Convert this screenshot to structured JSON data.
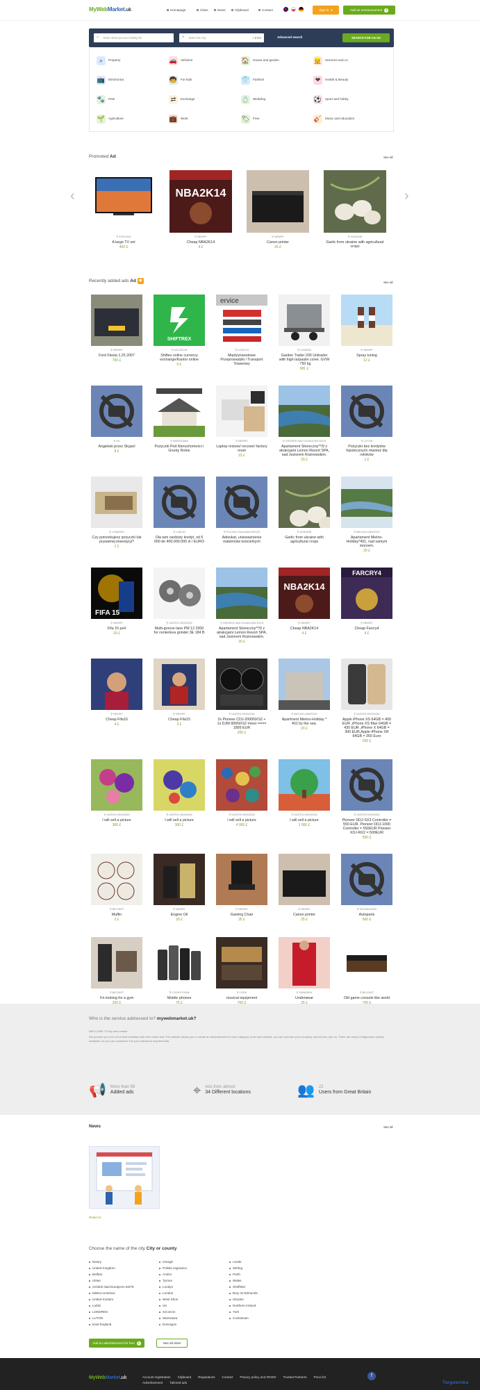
{
  "header": {
    "logo": {
      "my": "MyWeb",
      "market": "Market",
      "tld": ".uk"
    },
    "nav": [
      "Homepage",
      "Cities",
      "News",
      "Clipboard",
      "Contact"
    ],
    "sign_in": "Sign in",
    "add_announcement": "Add an announcement"
  },
  "search": {
    "what_placeholder": "Enter what you are looking for",
    "where_placeholder": "Enter the city",
    "radius": "+ 0 km",
    "advanced": "Advanced search",
    "button": "SEARCH FOR AN AD"
  },
  "categories": [
    {
      "label": "Property",
      "icon": "magnifier-house-icon"
    },
    {
      "label": "Vehicles",
      "icon": "car-icon"
    },
    {
      "label": "House and garden",
      "icon": "house-icon"
    },
    {
      "label": "Services and co.",
      "icon": "worker-icon"
    },
    {
      "label": "Electronics",
      "icon": "tv-icon"
    },
    {
      "label": "For kids",
      "icon": "kid-icon"
    },
    {
      "label": "Fashion",
      "icon": "shirt-icon"
    },
    {
      "label": "Health & Beauty",
      "icon": "heart-icon"
    },
    {
      "label": "Pets",
      "icon": "paw-icon"
    },
    {
      "label": "Exchange",
      "icon": "exchange-icon"
    },
    {
      "label": "Wedding",
      "icon": "rings-icon"
    },
    {
      "label": "Sport and hobby",
      "icon": "ball-icon"
    },
    {
      "label": "Agriculture",
      "icon": "plant-icon"
    },
    {
      "label": "Work",
      "icon": "briefcase-icon"
    },
    {
      "label": "Free",
      "icon": "tag-icon"
    },
    {
      "label": "Music and education",
      "icon": "guitar-icon"
    }
  ],
  "promoted": {
    "title_pre": "Promoted",
    "title_b": "Ad",
    "see_all": "See all",
    "items": [
      {
        "loc": "STIRLING",
        "title": "A large TV set",
        "price": "400 £"
      },
      {
        "loc": "NEWRY",
        "title": "Cheap NBA2K14",
        "price": "4 £"
      },
      {
        "loc": "NEWRY",
        "title": "Canon printer",
        "price": "25 £"
      },
      {
        "loc": "UKRAINE",
        "title": "Garlic from ukraine with agricultural crops",
        "price": ""
      }
    ]
  },
  "recent": {
    "title_pre": "Recently added ads",
    "title_b": "Ad",
    "see_all": "See all",
    "items": [
      {
        "loc": "NEWRY",
        "title": "Ford Fiesta 1,25 2007",
        "price": "700 £"
      },
      {
        "loc": "SZCZECIN",
        "title": "Shiftex online currency exchange/Kantor online",
        "price": "0 £"
      },
      {
        "loc": "LONDYN",
        "title": "Międzynarodowe Przeprowadzki i Transport Towarowy",
        "price": ""
      },
      {
        "loc": "LONDON",
        "title": "Garden Trailer 200 Unitrailer with high tarpaulin cover. GVW : 750 kg",
        "price": "581 £"
      },
      {
        "loc": "NEWRY",
        "title": "Spray tuning",
        "price": "12 £"
      },
      {
        "loc": "UK",
        "title": "Angielski przez Skypel",
        "price": "8 £"
      },
      {
        "loc": "WARSZAWA",
        "title": "Pożyczki Pod Nieruchomości i Grunty Rolne",
        "price": ""
      },
      {
        "loc": "NEWRY",
        "title": "Laptop restore/ recover/ factory reset",
        "price": "15 £"
      },
      {
        "loc": "GRÓDEK NAD DUNAJCEM 83/78",
        "title": "Apartament Słoneczny**/9 z atrakcjami Lemon Resort SPA, nad Jeziorem Rożnowskim.",
        "price": "20 £"
      },
      {
        "loc": "LUTON",
        "title": "Pożyczki bez kredytów hipotecznych również dla rolników",
        "price": "1 £"
      },
      {
        "loc": "LONDRES",
        "title": "Czy potrzebujesz pożyczki lub prywatnej inwestycji?",
        "price": "1 £"
      },
      {
        "loc": "LUBLIN",
        "title": "Ola tam osobisty kredyt, od 5 000 do 400.000.000 zł / EURO",
        "price": ""
      },
      {
        "loc": "POLSKA CAŁA/MAZOWSZE",
        "title": "Adwokat, unieważnienie małżeństw kościelnych",
        "price": ""
      },
      {
        "loc": "UKRAINE",
        "title": "Garlic from ukraine with agricultural crops",
        "price": ""
      },
      {
        "loc": "MIELNO-UNIEŚCIE",
        "title": "Apartament Mielno-Holiday*401, nad samym morzem.",
        "price": "20 £"
      },
      {
        "loc": "NEWRY",
        "title": "Fifa 15 ps4",
        "price": "20 £"
      },
      {
        "loc": "UNITED KINGDOM",
        "title": "Multi-groove lane PM 12 2000 for centerless grinder 3E 184 B",
        "price": ""
      },
      {
        "loc": "GRÓDEK NAD DUNAJCEM 83/78",
        "title": "Apartament Słoneczny**/9 z atrakcjami Lemon Resort SPA, nad Jeziorem Rożnowskim.",
        "price": "20 £"
      },
      {
        "loc": "NEWRY",
        "title": "Cheap NBA2K14",
        "price": "4 £"
      },
      {
        "loc": "NEWRY",
        "title": "Cheap Farcry4",
        "price": "4 £"
      },
      {
        "loc": "NEWRY",
        "title": "Cheap Fifa16",
        "price": "4 £"
      },
      {
        "loc": "NEWRY",
        "title": "Cheap Fifa15",
        "price": "3 £"
      },
      {
        "loc": "UNITED KINGDOM",
        "title": "2x Pioneer CDJ-2000NXS2 + 1x DJM-900NXS2 mixer ==== 1899 EUR",
        "price": "200 £"
      },
      {
        "loc": "MIELNO-UNIEŚCIE",
        "title": "Apartment Mielno-Holiday * 401 by the sea.",
        "price": "20 £"
      },
      {
        "loc": "UNITED KINGDOM",
        "title": "Apple iPhone XS 64GB = 400 EUR ,iPhone XS Max 64GB = 430 EUR ,iPhone X 64GB = 300 EUR,Apple iPhone XR 64GB = 350 Euro",
        "price": "200 £"
      },
      {
        "loc": "UNITED KINGDOM",
        "title": "I will sell a picture",
        "price": "300 £"
      },
      {
        "loc": "UNITED KINGDOM",
        "title": "I will sell a picture",
        "price": "300 £"
      },
      {
        "loc": "UNITED KINGDOM",
        "title": "I will sell a picture",
        "price": "4 000 £"
      },
      {
        "loc": "UNITED KINGDOM",
        "title": "I will sell a picture",
        "price": "1 000 £"
      },
      {
        "loc": "UNITED KINGDOM",
        "title": "Pioneer DDJ-SX3 Controller = 550 EUR, Pioneer DDJ-1000 Controller = 550EUR Pioneer XDJ-RX2 = 500EUR",
        "price": "550 £"
      },
      {
        "loc": "BELFAST",
        "title": "Muffin",
        "price": "2 £"
      },
      {
        "loc": "NEWRY",
        "title": "Engine Oil",
        "price": "30 £"
      },
      {
        "loc": "NEWRY",
        "title": "Gaming Chair",
        "price": "35 £"
      },
      {
        "loc": "NEWRY",
        "title": "Canon printer",
        "price": "25 £"
      },
      {
        "loc": "SOSNAGORA",
        "title": "Autoparts",
        "price": "500 £"
      },
      {
        "loc": "BELFAST",
        "title": "I'm looking for a gym",
        "price": "200 £"
      },
      {
        "loc": "COOKSTOWN",
        "title": "Mobile phones",
        "price": "75 £"
      },
      {
        "loc": "YORK",
        "title": "musical equipment",
        "price": "700 £"
      },
      {
        "loc": "SWANSEA",
        "title": "Underwear",
        "price": "25 £"
      },
      {
        "loc": "BELFAST",
        "title": "Old game console like world",
        "price": "700 £"
      }
    ]
  },
  "about": {
    "q_pre": "Who is the service addressed to?",
    "q_b": "mywebmarket.uk?",
    "welcome": "WELCOME TO My web market",
    "text": "We present you one of the best websites with free online ads! The website allows you to create an advertisement in each category, local and national, you can promote your company and service, join us. There are many configuration options available, so you can customize it to your individual requirements.",
    "stats": [
      {
        "num": "More than 59",
        "label": "Added ads"
      },
      {
        "num": "Ads from almost",
        "label": "34 Different locations"
      },
      {
        "num": "22",
        "label": "Users from Great Britain"
      }
    ]
  },
  "news": {
    "title": "News",
    "see_all": "See all",
    "read_on": "Read on"
  },
  "cities": {
    "title_pre": "Choose the name of the city",
    "title_b": "City or county",
    "cols": [
      [
        "Newry",
        "United Kingdom",
        "Belfast",
        "Ulster",
        "Gródek Nad Dunajcem 83/78",
        "Mielno-Unieście",
        "United Kindom",
        "Lublin",
        "LONDRES",
        "LUTON",
        "East England"
      ],
      [
        "Omagh",
        "Polska zagranica",
        "Antrim",
        "Tyrone",
        "Londyn",
        "London",
        "West Shoe",
        "UK",
        "Szczecin",
        "Warszawa",
        "Dunragon"
      ],
      [
        "Leeds",
        "Stirling",
        "Perth",
        "Wales",
        "Sheffield",
        "Bury St Edmunds",
        "Ukraine",
        "Northern Ireland",
        "York",
        "Cookstown"
      ],
      []
    ],
    "add_free": "Add an advertisement for free",
    "see_all_cities": "See all cities"
  },
  "footer": {
    "links": [
      "Account registration",
      "Clipboard",
      "Regulations",
      "Contact",
      "Privacy policy and RODO",
      "Trusted Partners",
      "Price list",
      "Advertisement",
      "Tailored ads"
    ],
    "brand": "Targowiska"
  },
  "colors": {
    "green": "#6aaa1e",
    "orange": "#f4a21d",
    "navy": "#2e3d57",
    "blue": "#2d62b0"
  }
}
